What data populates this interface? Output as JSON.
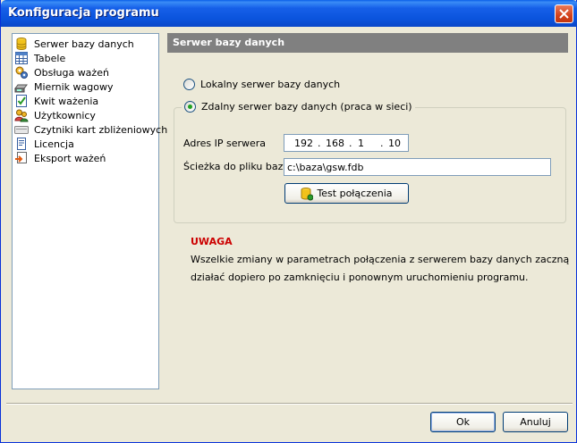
{
  "window": {
    "title": "Konfiguracja programu"
  },
  "sidebar": {
    "items": [
      {
        "label": "Serwer bazy danych",
        "icon": "database-icon"
      },
      {
        "label": "Tabele",
        "icon": "table-icon"
      },
      {
        "label": "Obsługa ważeń",
        "icon": "gears-icon"
      },
      {
        "label": "Miernik wagowy",
        "icon": "scale-icon"
      },
      {
        "label": "Kwit ważenia",
        "icon": "receipt-icon"
      },
      {
        "label": "Użytkownicy",
        "icon": "users-icon"
      },
      {
        "label": "Czytniki kart zbliżeniowych",
        "icon": "card-reader-icon"
      },
      {
        "label": "Licencja",
        "icon": "license-icon"
      },
      {
        "label": "Eksport ważeń",
        "icon": "export-icon"
      }
    ]
  },
  "panel": {
    "header": "Serwer bazy danych",
    "radio_local": "Lokalny serwer bazy danych",
    "radio_remote": "Zdalny serwer bazy danych (praca w sieci)",
    "ip_label": "Adres IP serwera",
    "ip": [
      "192",
      "168",
      "1",
      "10"
    ],
    "path_label": "Ścieżka do pliku bazy",
    "path_value": "c:\\baza\\gsw.fdb",
    "test_button": "Test połączenia",
    "warning_title": "UWAGA",
    "warning_line1": "Wszelkie zmiany w parametrach połączenia z serwerem bazy danych zaczną",
    "warning_line2": "działać dopiero po zamknięciu i ponownym uruchomieniu programu."
  },
  "buttons": {
    "ok": "Ok",
    "cancel": "Anuluj"
  }
}
